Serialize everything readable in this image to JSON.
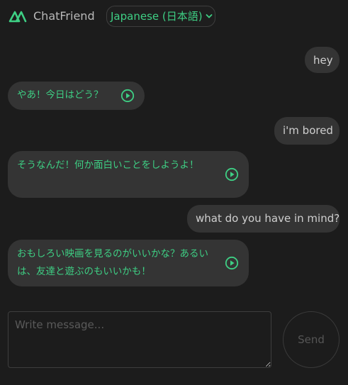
{
  "header": {
    "brand": "ChatFriend",
    "language_selected": "Japanese (日本語)"
  },
  "messages": [
    {
      "role": "user",
      "text": "hey"
    },
    {
      "role": "bot",
      "text": "やあ！今日はどう？"
    },
    {
      "role": "user",
      "text": "i'm bored"
    },
    {
      "role": "bot",
      "text": "そうなんだ！何か面白いことをしようよ！"
    },
    {
      "role": "user",
      "text": "what do you have in mind?"
    },
    {
      "role": "bot",
      "text": "おもしろい映画を見るのがいいかな？あるいは、友達と遊ぶのもいいかも！"
    }
  ],
  "composer": {
    "placeholder": "Write message...",
    "value": "",
    "send_label": "Send"
  },
  "colors": {
    "background": "#1c1c1c",
    "bubble": "#343434",
    "accent": "#3ecf84",
    "user_text": "#cfcfcf"
  },
  "icons": {
    "logo": "chatfriend-logo-icon",
    "play": "play-circle-icon",
    "chevron": "chevron-down-icon"
  }
}
